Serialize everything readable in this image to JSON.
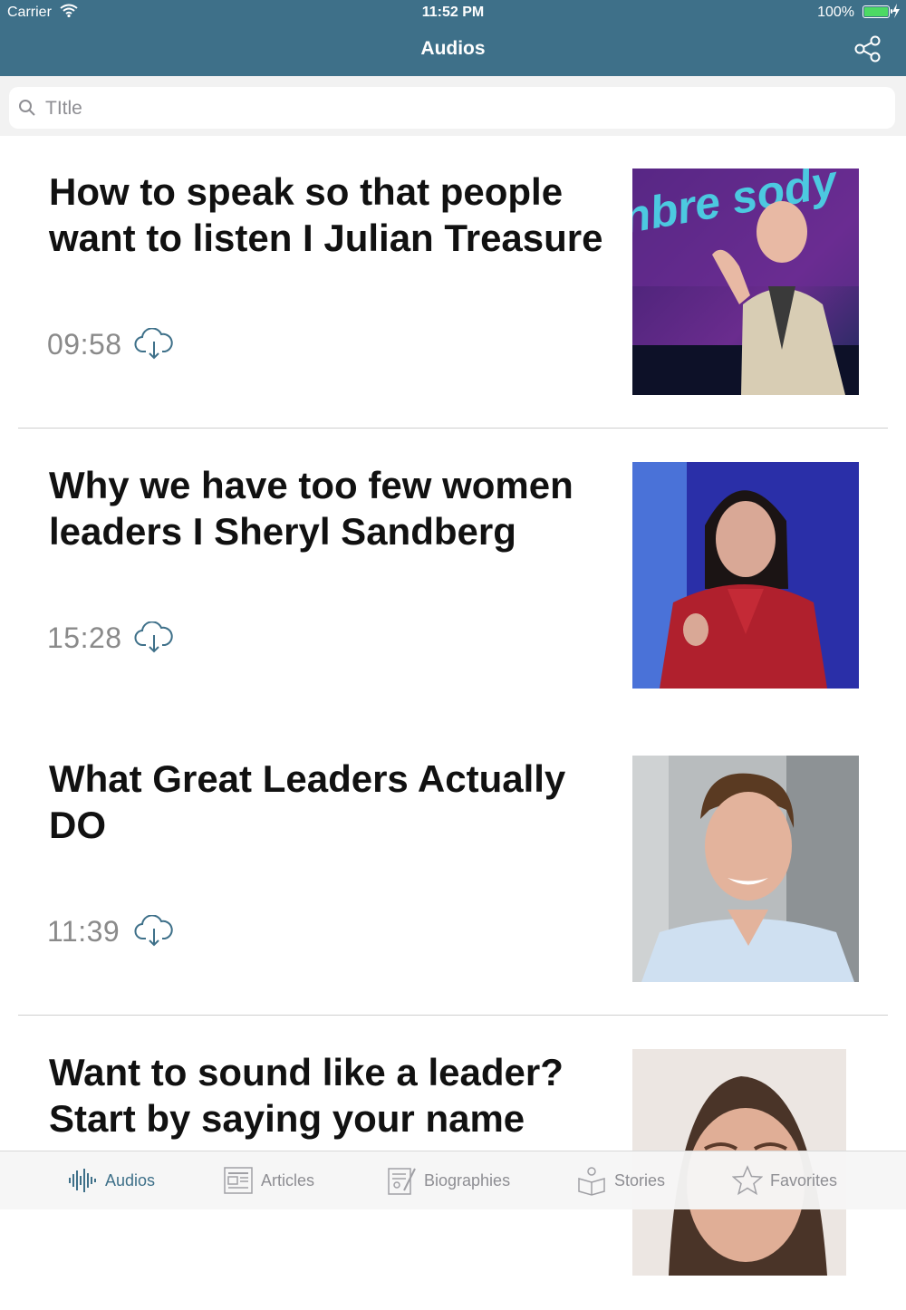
{
  "status_bar": {
    "carrier": "Carrier",
    "time": "11:52 PM",
    "battery": "100%"
  },
  "nav": {
    "title": "Audios",
    "share_icon": "share-icon"
  },
  "search": {
    "placeholder": "TItle",
    "value": ""
  },
  "items": [
    {
      "title": "How to speak so that people want to listen I Julian Treasure",
      "duration": "09:58",
      "thumbnail_text": "nbre sody"
    },
    {
      "title": "Why we have too few women leaders I Sheryl Sandberg",
      "duration": "15:28"
    },
    {
      "title": "What Great Leaders Actually DO",
      "duration": "11:39"
    },
    {
      "title": "Want to sound like a leader? Start by saying your name",
      "duration": ""
    }
  ],
  "tabs": [
    {
      "label": "Audios",
      "icon": "waveform-icon",
      "active": true
    },
    {
      "label": "Articles",
      "icon": "newspaper-icon",
      "active": false
    },
    {
      "label": "Biographies",
      "icon": "notebook-icon",
      "active": false
    },
    {
      "label": "Stories",
      "icon": "reading-person-icon",
      "active": false
    },
    {
      "label": "Favorites",
      "icon": "star-icon",
      "active": false
    }
  ],
  "colors": {
    "nav_background": "#3e7089",
    "accent": "#3e7089",
    "battery": "#4cd964"
  }
}
